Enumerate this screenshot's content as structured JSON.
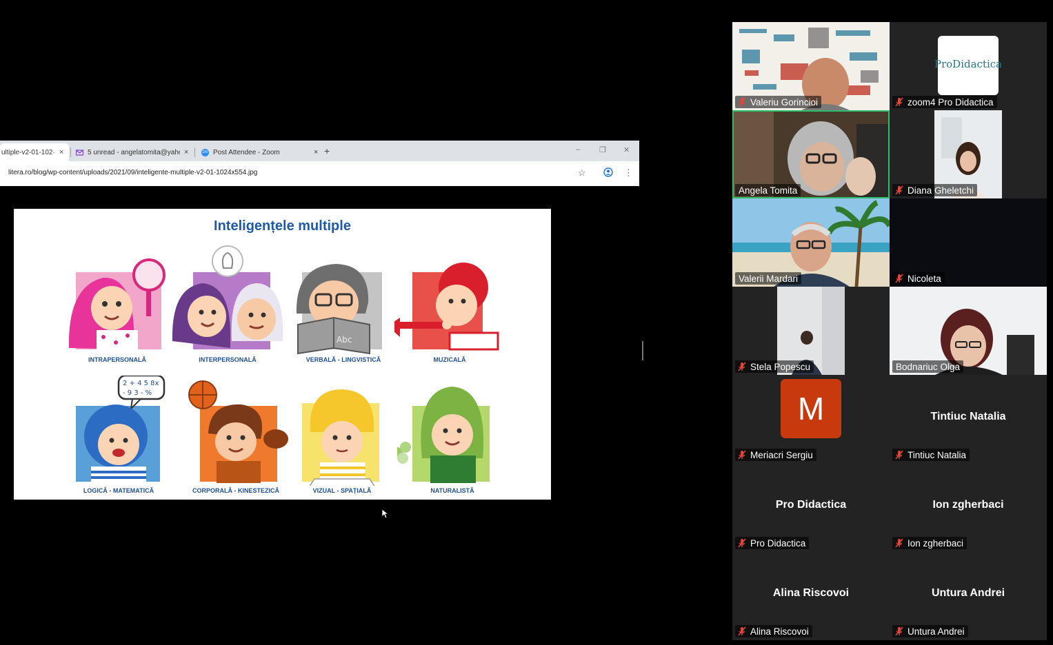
{
  "browser": {
    "tabs": [
      {
        "label": "ultiple-v2-01-102·",
        "close": "×",
        "active": true
      },
      {
        "label": "5 unread - angelatomita@yaho",
        "close": "×",
        "icon": "mail-icon"
      },
      {
        "label": "Post Attendee - Zoom",
        "close": "×",
        "icon": "zoom-icon",
        "icon_text": "zm"
      }
    ],
    "new_tab": "+",
    "window_controls": [
      "–",
      "❐",
      "✕"
    ],
    "url": "litera.ro/blog/wp-content/uploads/2021/09/inteligente-multiple-v2-01-1024x554.jpg",
    "star": "☆",
    "menu": "⋮"
  },
  "slide": {
    "title": "Inteligențele multiple",
    "intelligences": [
      {
        "label": "INTRAPERSONALĂ"
      },
      {
        "label": "INTERPERSONALĂ"
      },
      {
        "label": "VERBALĂ - LINGVISTICĂ",
        "book_text": "Abc"
      },
      {
        "label": "MUZICALĂ"
      },
      {
        "label": "LOGICĂ - MATEMATICĂ",
        "bubble_text_1": "2 + 4 5 8x",
        "bubble_text_2": "- 9 3 - %"
      },
      {
        "label": "CORPORALĂ - KINESTEZICĂ"
      },
      {
        "label": "VIZUAL - SPAȚIALĂ"
      },
      {
        "label": "NATURALISTĂ"
      }
    ]
  },
  "gallery": {
    "participants": [
      {
        "name": "Valeriu Gorincioi",
        "muted": true,
        "video": true
      },
      {
        "name": "zoom4 Pro Didactica",
        "muted": true,
        "video": true,
        "logo_text": "ProDidactica"
      },
      {
        "name": "Angela Tomita",
        "muted": false,
        "video": true,
        "speaking": true
      },
      {
        "name": "Diana Gheletchi",
        "muted": true,
        "video": true
      },
      {
        "name": "Valerii Mardari",
        "muted": false,
        "video": true
      },
      {
        "name": "Nicoleta",
        "muted": true,
        "video": false
      },
      {
        "name": "Stela Popescu",
        "muted": true,
        "video": true
      },
      {
        "name": "Bodnariuc Olga",
        "muted": false,
        "video": true
      },
      {
        "name": "Meriacri Sergiu",
        "muted": true,
        "avatar_letter": "M"
      },
      {
        "name": "Tintiuc Natalia",
        "muted": true,
        "display_name": "Tintiuc Natalia"
      },
      {
        "name": "Pro Didactica",
        "muted": true,
        "display_name": "Pro Didactica"
      },
      {
        "name": "Ion zgherbaci",
        "muted": true,
        "display_name": "Ion zgherbaci"
      },
      {
        "name": "Alina Riscovoi",
        "muted": true,
        "display_name": "Alina Riscovoi"
      },
      {
        "name": "Untura Andrei",
        "muted": true,
        "display_name": "Untura Andrei"
      }
    ]
  },
  "colors": {
    "background": "#000000",
    "tile": "#232323",
    "speaking_border": "#2dbf6a",
    "muted_mic": "#e0463c",
    "slide_title": "#1e5aa8",
    "avatar": "#c83a0e"
  }
}
